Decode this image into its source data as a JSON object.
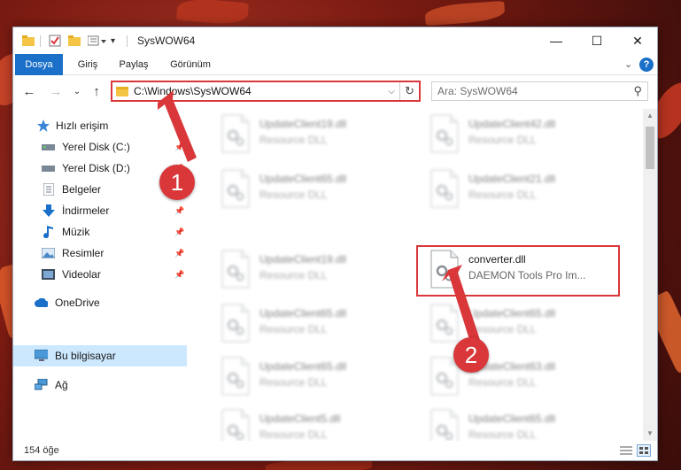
{
  "window": {
    "title": "SysWOW64",
    "controls": {
      "minimize": "—",
      "maximize": "☐",
      "close": "✕"
    }
  },
  "ribbon": {
    "tabs": [
      "Dosya",
      "Giriş",
      "Paylaş",
      "Görünüm"
    ],
    "collapse": "⌄",
    "help": "?"
  },
  "nav": {
    "back": "←",
    "forward": "→",
    "recent": "⌄",
    "up": "↑",
    "address_path": "C:\\Windows\\SysWOW64",
    "address_dropdown": "⌵",
    "refresh": "↻",
    "search_placeholder": "Ara: SysWOW64",
    "search_icon": "⚲"
  },
  "sidebar": {
    "items": [
      {
        "label": "Hızlı erişim",
        "icon": "star-icon"
      },
      {
        "label": "Yerel Disk (C:)",
        "icon": "drive-icon",
        "pinned": true
      },
      {
        "label": "Yerel Disk (D:)",
        "icon": "drive-icon",
        "pinned": true
      },
      {
        "label": "Belgeler",
        "icon": "documents-icon",
        "pinned": true
      },
      {
        "label": "İndirmeler",
        "icon": "download-icon",
        "pinned": true
      },
      {
        "label": "Müzik",
        "icon": "music-icon",
        "pinned": true
      },
      {
        "label": "Resimler",
        "icon": "pictures-icon",
        "pinned": true
      },
      {
        "label": "Videolar",
        "icon": "videos-icon",
        "pinned": true
      },
      {
        "label": "OneDrive",
        "icon": "cloud-icon"
      },
      {
        "label": "Bu bilgisayar",
        "icon": "computer-icon",
        "selected": true
      },
      {
        "label": "Ağ",
        "icon": "network-icon"
      }
    ]
  },
  "files": {
    "left_column": [
      {
        "name": "UpdateClient19.dll",
        "desc": "Resource DLL"
      },
      {
        "name": "UpdateClient65.dll",
        "desc": "Resource DLL"
      },
      {
        "name": "UpdateClient19.dll",
        "desc": "Resource DLL"
      },
      {
        "name": "UpdateClient65.dll",
        "desc": "Resource DLL"
      },
      {
        "name": "UpdateClient65.dll",
        "desc": "Resource DLL"
      },
      {
        "name": "UpdateClient5.dll",
        "desc": "Resource DLL"
      }
    ],
    "right_column": [
      {
        "name": "UpdateClient42.dll",
        "desc": "Resource DLL"
      },
      {
        "name": "UpdateClient21.dll",
        "desc": "Resource DLL"
      },
      {
        "name": "converter.dll",
        "desc": "DAEMON Tools Pro Im...",
        "highlighted": true
      },
      {
        "name": "UpdateClient65.dll",
        "desc": "Resource DLL"
      },
      {
        "name": "UpdateClient63.dll",
        "desc": "Resource DLL"
      },
      {
        "name": "UpdateClient65.dll",
        "desc": "Resource DLL"
      }
    ]
  },
  "status": {
    "item_count": "154 öğe"
  },
  "annotations": {
    "badge1": "1",
    "badge2": "2"
  },
  "colors": {
    "accent": "#1a6fc9",
    "highlight": "#d9373a",
    "selected": "#cce8ff"
  }
}
